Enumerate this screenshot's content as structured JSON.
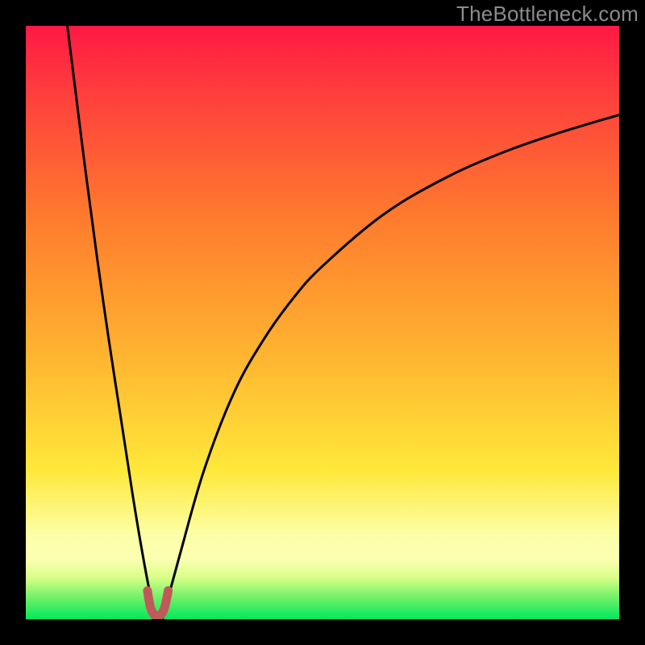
{
  "watermark": "TheBottleneck.com",
  "colors": {
    "frame": "#000000",
    "gradient_top_hot": "#ff1844",
    "gradient_mid_orange": "#ff8a2a",
    "gradient_mid_yellow": "#ffe73a",
    "gradient_pale_band": "#fbffb0",
    "gradient_green": "#00e85c",
    "curve": "#000000",
    "marker": "#c05a5a"
  },
  "chart_data": {
    "type": "line",
    "title": "",
    "xlabel": "",
    "ylabel": "",
    "xlim": [
      0,
      1
    ],
    "ylim": [
      0,
      1
    ],
    "notes": "Two black curves on a vertical red→yellow→green gradient. Both curves descend to a shared minimum at x≈0.22 near y=0, with a small rounded pink marker at the bottom. Left curve rises steeply toward x≈0.07 at the top edge; right curve rises with decreasing slope to y≈0.85 at x=1.",
    "minimum": {
      "x": 0.22,
      "y": 0.0
    },
    "series": [
      {
        "name": "left-branch",
        "x": [
          0.07,
          0.085,
          0.1,
          0.12,
          0.14,
          0.16,
          0.18,
          0.195,
          0.21,
          0.22
        ],
        "y": [
          1.0,
          0.88,
          0.76,
          0.61,
          0.47,
          0.34,
          0.21,
          0.12,
          0.04,
          0.0
        ]
      },
      {
        "name": "right-branch",
        "x": [
          0.23,
          0.26,
          0.3,
          0.35,
          0.4,
          0.45,
          0.5,
          0.6,
          0.7,
          0.8,
          0.9,
          1.0
        ],
        "y": [
          0.0,
          0.11,
          0.25,
          0.38,
          0.47,
          0.54,
          0.595,
          0.68,
          0.74,
          0.785,
          0.82,
          0.85
        ]
      }
    ],
    "marker_path_xy": [
      [
        0.205,
        0.048
      ],
      [
        0.21,
        0.02
      ],
      [
        0.216,
        0.008
      ],
      [
        0.222,
        0.006
      ],
      [
        0.228,
        0.008
      ],
      [
        0.234,
        0.02
      ],
      [
        0.24,
        0.048
      ]
    ]
  }
}
